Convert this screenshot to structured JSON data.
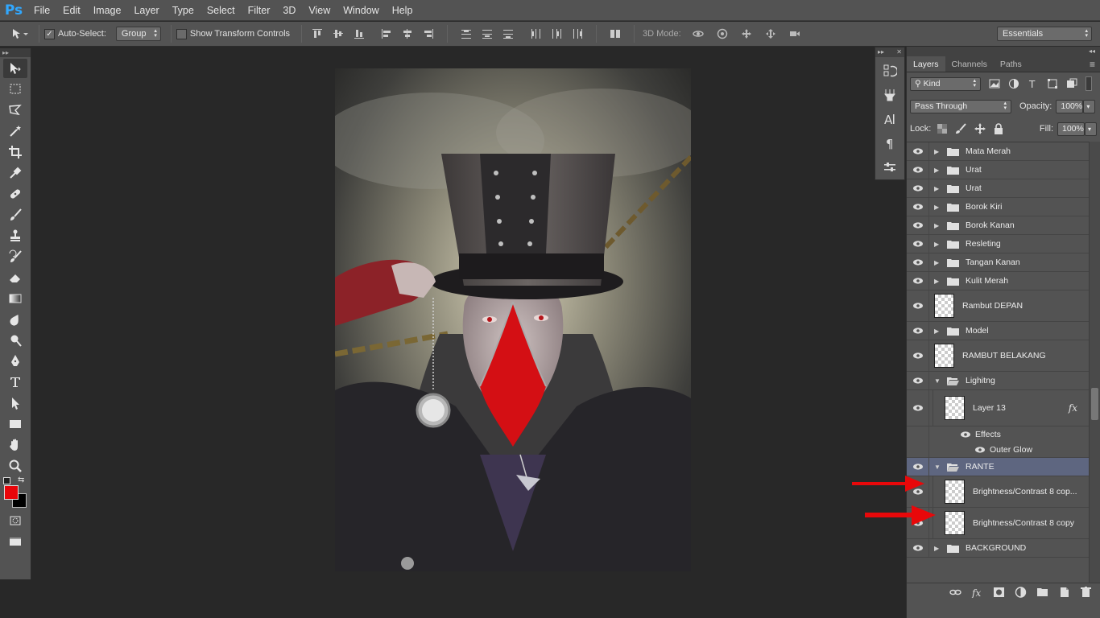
{
  "app": {
    "logo": "Ps"
  },
  "menu": [
    "File",
    "Edit",
    "Image",
    "Layer",
    "Type",
    "Select",
    "Filter",
    "3D",
    "View",
    "Window",
    "Help"
  ],
  "options": {
    "auto_select_label": "Auto-Select:",
    "auto_select_checked": true,
    "auto_select_target": "Group",
    "show_transform_label": "Show Transform Controls",
    "show_transform_checked": false,
    "mode_3d_label": "3D Mode:",
    "workspace": "Essentials"
  },
  "toolbox": {
    "tools": [
      "move-tool",
      "marquee-tool",
      "lasso-tool",
      "magic-wand-tool",
      "crop-tool",
      "eyedropper-tool",
      "healing-tool",
      "brush-tool",
      "stamp-tool",
      "history-brush-tool",
      "eraser-tool",
      "gradient-tool",
      "blur-tool",
      "dodge-tool",
      "pen-tool",
      "type-tool",
      "path-select-tool",
      "rectangle-tool",
      "hand-tool",
      "zoom-tool"
    ],
    "foreground_color": "#e8050a",
    "background_color": "#000000"
  },
  "panel": {
    "tabs": [
      "Layers",
      "Channels",
      "Paths"
    ],
    "active_tab": "Layers",
    "filter_kind": "Kind",
    "blend_mode": "Pass Through",
    "opacity_label": "Opacity:",
    "opacity_value": "100%",
    "lock_label": "Lock:",
    "fill_label": "Fill:",
    "fill_value": "100%"
  },
  "layers": [
    {
      "name": "Mata Merah",
      "type": "group",
      "expanded": false
    },
    {
      "name": "Urat",
      "type": "group",
      "expanded": false
    },
    {
      "name": "Urat",
      "type": "group",
      "expanded": false
    },
    {
      "name": "Borok Kiri",
      "type": "group",
      "expanded": false
    },
    {
      "name": "Borok Kanan",
      "type": "group",
      "expanded": false
    },
    {
      "name": "Resleting",
      "type": "group",
      "expanded": false
    },
    {
      "name": "Tangan Kanan",
      "type": "group",
      "expanded": false
    },
    {
      "name": "Kulit Merah",
      "type": "group",
      "expanded": false
    },
    {
      "name": "Rambut DEPAN",
      "type": "layer"
    },
    {
      "name": "Model",
      "type": "group",
      "expanded": false
    },
    {
      "name": "RAMBUT BELAKANG",
      "type": "layer"
    },
    {
      "name": "Lighitng",
      "type": "group",
      "expanded": true
    },
    {
      "name": "Layer 13",
      "type": "layer",
      "indent": true,
      "fx": "fx"
    },
    {
      "name": "Effects",
      "type": "effect"
    },
    {
      "name": "Outer Glow",
      "type": "effect-item"
    },
    {
      "name": "RANTE",
      "type": "group",
      "expanded": true,
      "selected": true
    },
    {
      "name": "Brightness/Contrast 8 cop...",
      "type": "layer",
      "indent": true
    },
    {
      "name": "Brightness/Contrast 8 copy",
      "type": "layer",
      "indent": true
    },
    {
      "name": "BACKGROUND",
      "type": "group",
      "expanded": false
    }
  ],
  "colors": {
    "accent_arrow": "#e8080a",
    "selection": "#5e6680"
  }
}
